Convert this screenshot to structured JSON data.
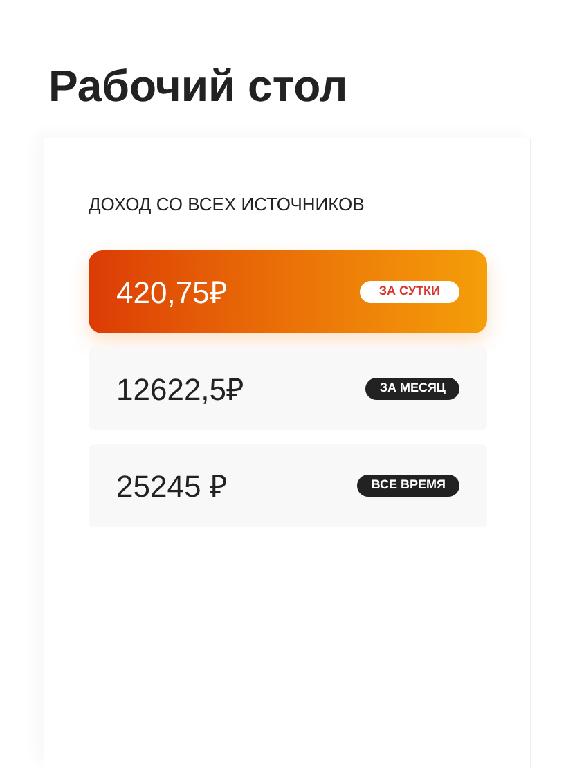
{
  "page": {
    "title": "Рабочий стол"
  },
  "income": {
    "heading": "ДОХОД СО ВСЕХ ИСТОЧНИКОВ",
    "cards": [
      {
        "amount": "420,75₽",
        "period": "ЗА СУТКИ",
        "selected": true
      },
      {
        "amount": "12622,5₽",
        "period": "ЗА МЕСЯЦ",
        "selected": false
      },
      {
        "amount": "25245 ₽",
        "period": "ВСЕ ВРЕМЯ",
        "selected": false
      }
    ]
  }
}
